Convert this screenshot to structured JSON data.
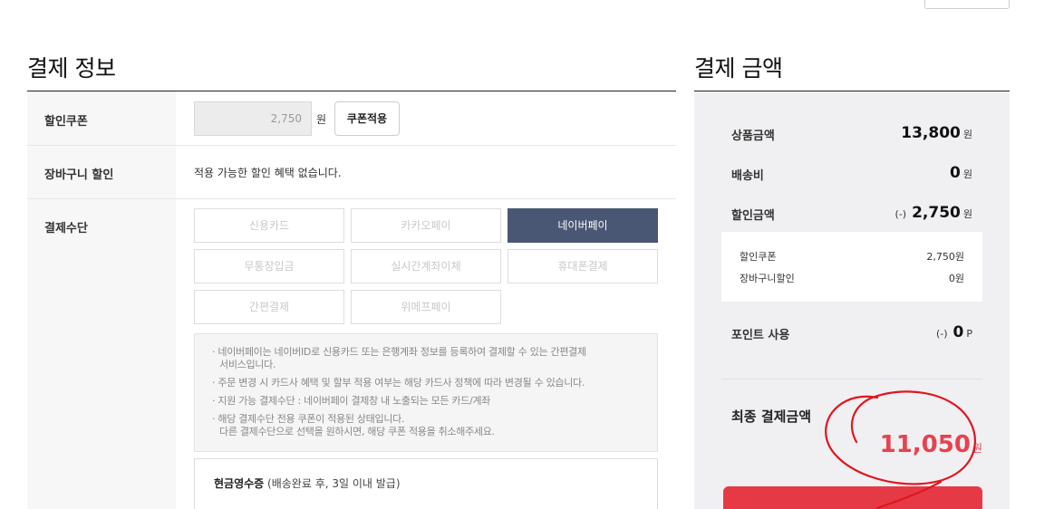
{
  "left": {
    "title": "결제 정보",
    "coupon": {
      "label": "할인쿠폰",
      "value": "2,750",
      "unit": "원",
      "apply_label": "쿠폰적용"
    },
    "cart_discount": {
      "label": "장바구니 할인",
      "text": "적용 가능한 할인 혜택 없습니다."
    },
    "payment": {
      "label": "결제수단",
      "methods": [
        {
          "label": "신용카드",
          "active": false
        },
        {
          "label": "카카오페이",
          "active": false
        },
        {
          "label": "네이버페이",
          "active": true
        },
        {
          "label": "무통장입금",
          "active": false
        },
        {
          "label": "실시간계좌이체",
          "active": false
        },
        {
          "label": "휴대폰결제",
          "active": false
        },
        {
          "label": "간편결제",
          "active": false
        },
        {
          "label": "위메프페이",
          "active": false
        }
      ],
      "notes": [
        "· 네이버페이는 네이버ID로 신용카드 또는 은행계좌 정보를 등록하여 결제할 수 있는 간편결제",
        "서비스입니다.",
        "· 주문 변경 시 카드사 혜택 및 할부 적용 여부는 해당 카드사 정책에 따라 변경될 수 있습니다.",
        "· 지원 가능 결제수단 : 네이버페이 결제창 내 노출되는 모든 카드/계좌",
        "· 해당 결제수단 전용 쿠폰이 적용된 상태입니다.",
        "다른 결제수단으로 선택을 원하시면, 해당 쿠폰 적용을 취소해주세요."
      ]
    },
    "receipt": {
      "title": "현금영수증",
      "note": "(배송완료 후, 3일 이내 발급)"
    }
  },
  "right": {
    "title": "결제 금액",
    "product_amount": {
      "label": "상품금액",
      "value": "13,800",
      "unit": "원"
    },
    "shipping": {
      "label": "배송비",
      "value": "0",
      "unit": "원"
    },
    "discount": {
      "label": "할인금액",
      "prefix": "(-)",
      "value": "2,750",
      "unit": "원"
    },
    "discount_detail": [
      {
        "label": "할인쿠폰",
        "value": "2,750원"
      },
      {
        "label": "장바구니할인",
        "value": "0원"
      }
    ],
    "points": {
      "label": "포인트 사용",
      "prefix": "(-)",
      "value": "0",
      "unit": "P"
    },
    "final": {
      "label": "최종 결제금액",
      "value": "11,050",
      "unit": "원"
    }
  },
  "colors": {
    "accent": "#e8414f",
    "active_method": "#4a5774",
    "annotation": "#e0161e"
  }
}
